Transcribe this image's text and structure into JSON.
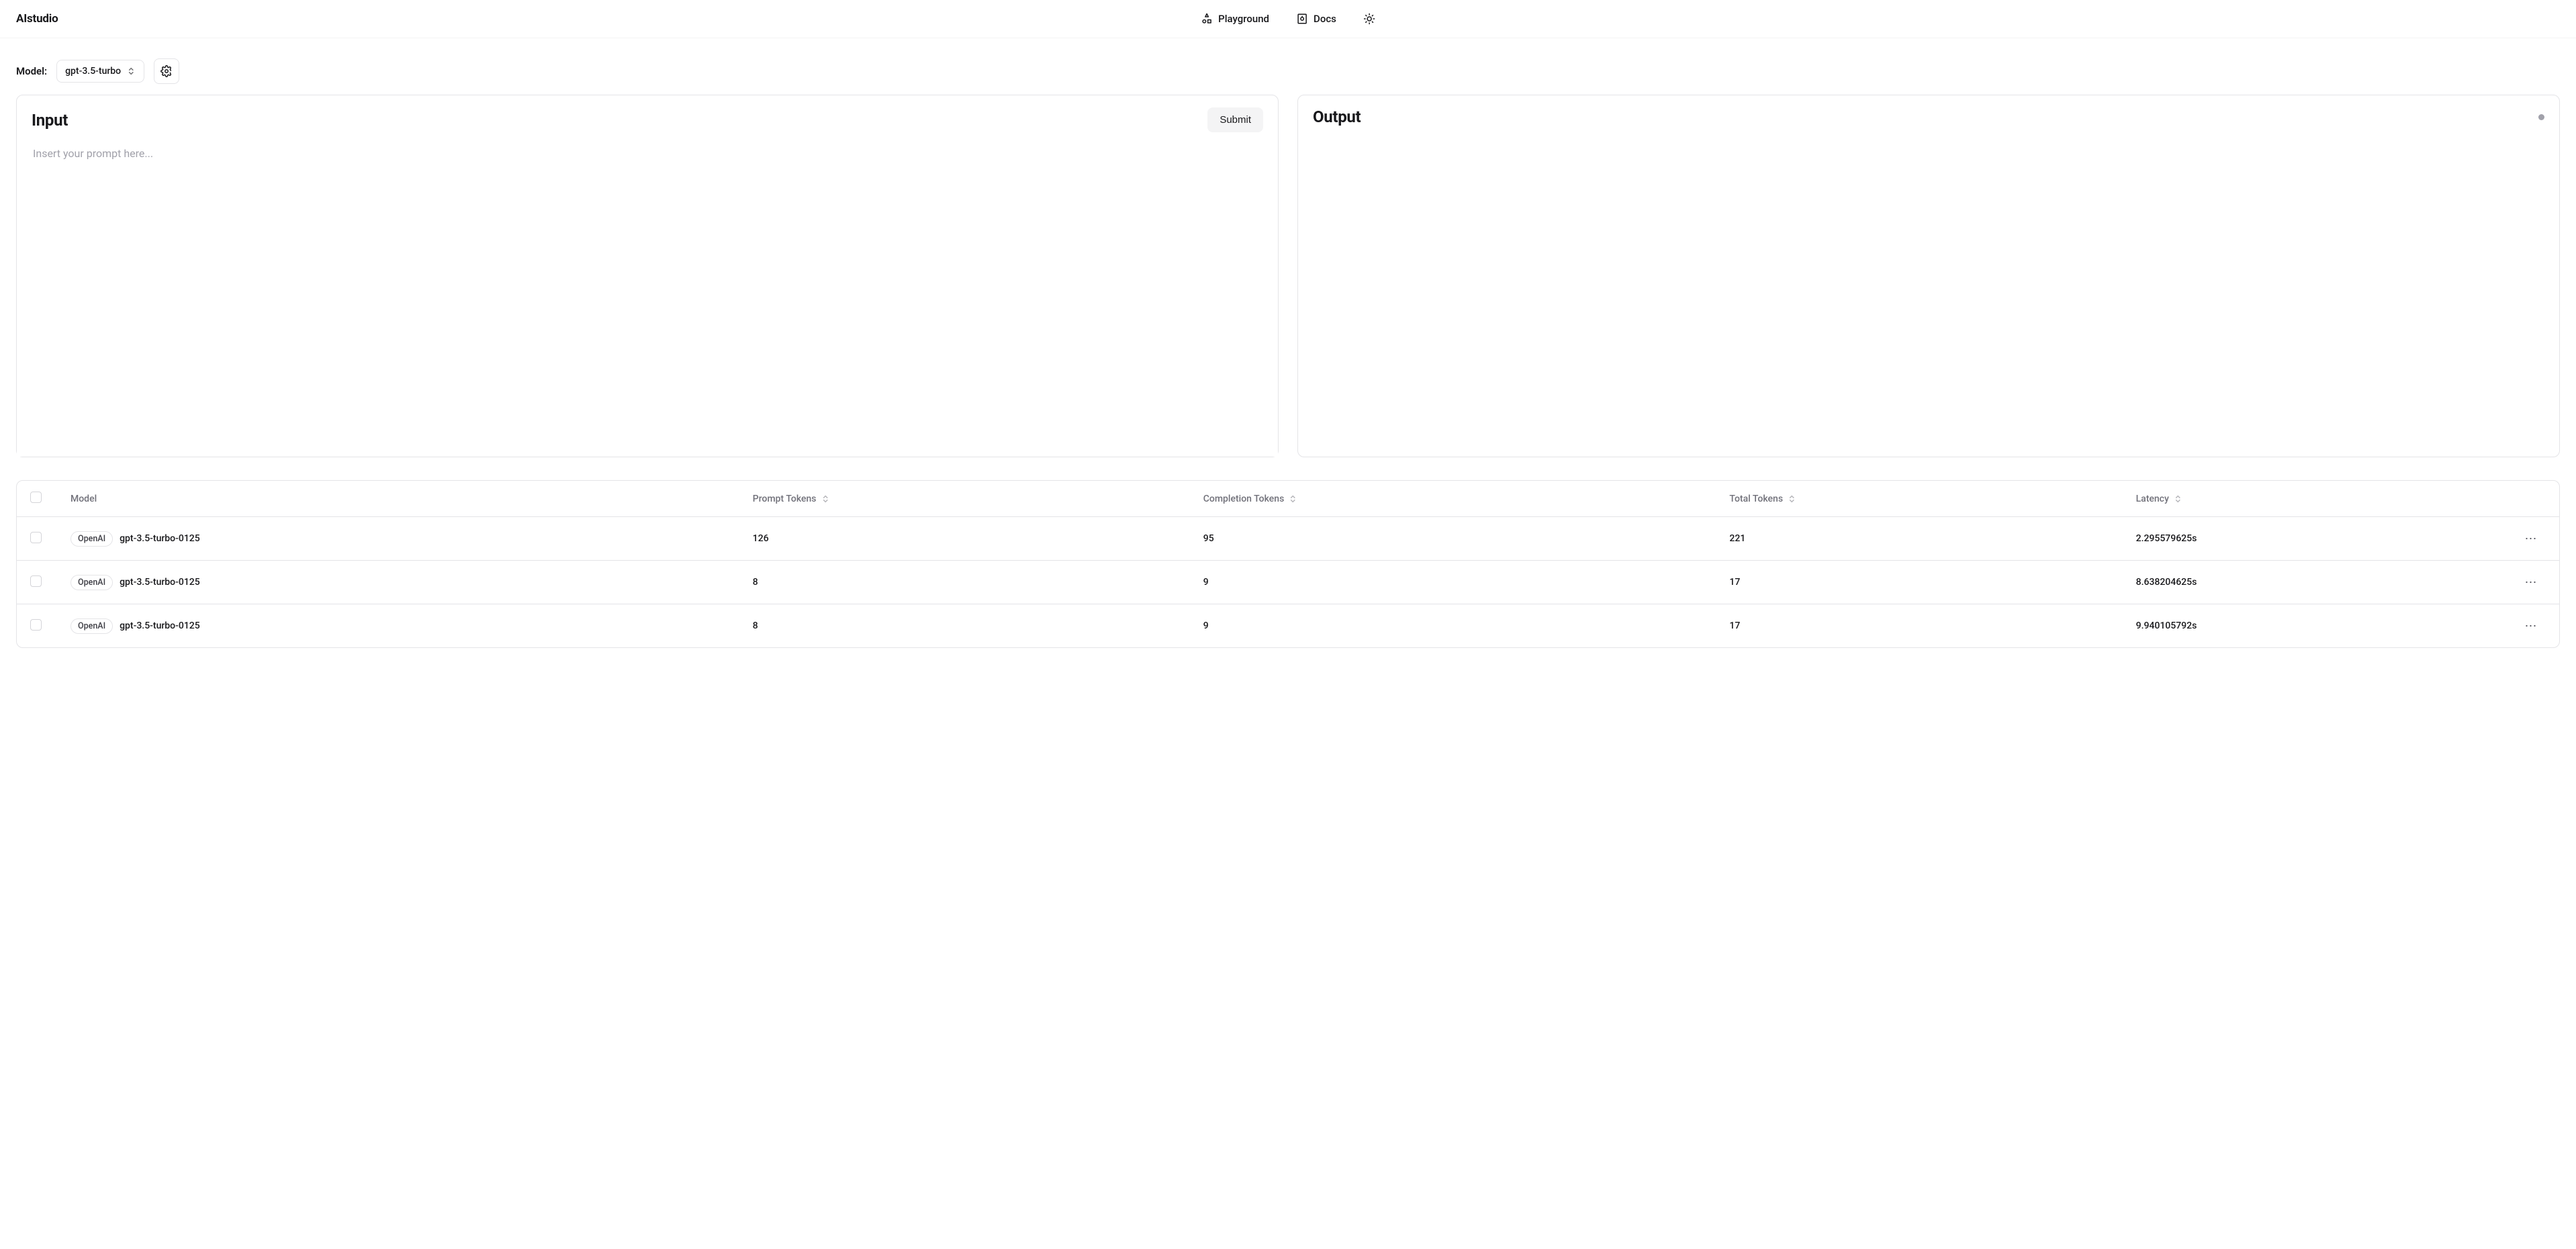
{
  "header": {
    "brand": "AIstudio",
    "nav": {
      "playground": "Playground",
      "docs": "Docs"
    }
  },
  "model_section": {
    "label": "Model:",
    "selected": "gpt-3.5-turbo"
  },
  "input_panel": {
    "title": "Input",
    "submit_label": "Submit",
    "placeholder": "Insert your prompt here..."
  },
  "output_panel": {
    "title": "Output"
  },
  "table": {
    "headers": {
      "model": "Model",
      "prompt_tokens": "Prompt Tokens",
      "completion_tokens": "Completion Tokens",
      "total_tokens": "Total Tokens",
      "latency": "Latency"
    },
    "rows": [
      {
        "provider": "OpenAI",
        "model": "gpt-3.5-turbo-0125",
        "prompt_tokens": "126",
        "completion_tokens": "95",
        "total_tokens": "221",
        "latency": "2.295579625s"
      },
      {
        "provider": "OpenAI",
        "model": "gpt-3.5-turbo-0125",
        "prompt_tokens": "8",
        "completion_tokens": "9",
        "total_tokens": "17",
        "latency": "8.638204625s"
      },
      {
        "provider": "OpenAI",
        "model": "gpt-3.5-turbo-0125",
        "prompt_tokens": "8",
        "completion_tokens": "9",
        "total_tokens": "17",
        "latency": "9.940105792s"
      }
    ]
  }
}
